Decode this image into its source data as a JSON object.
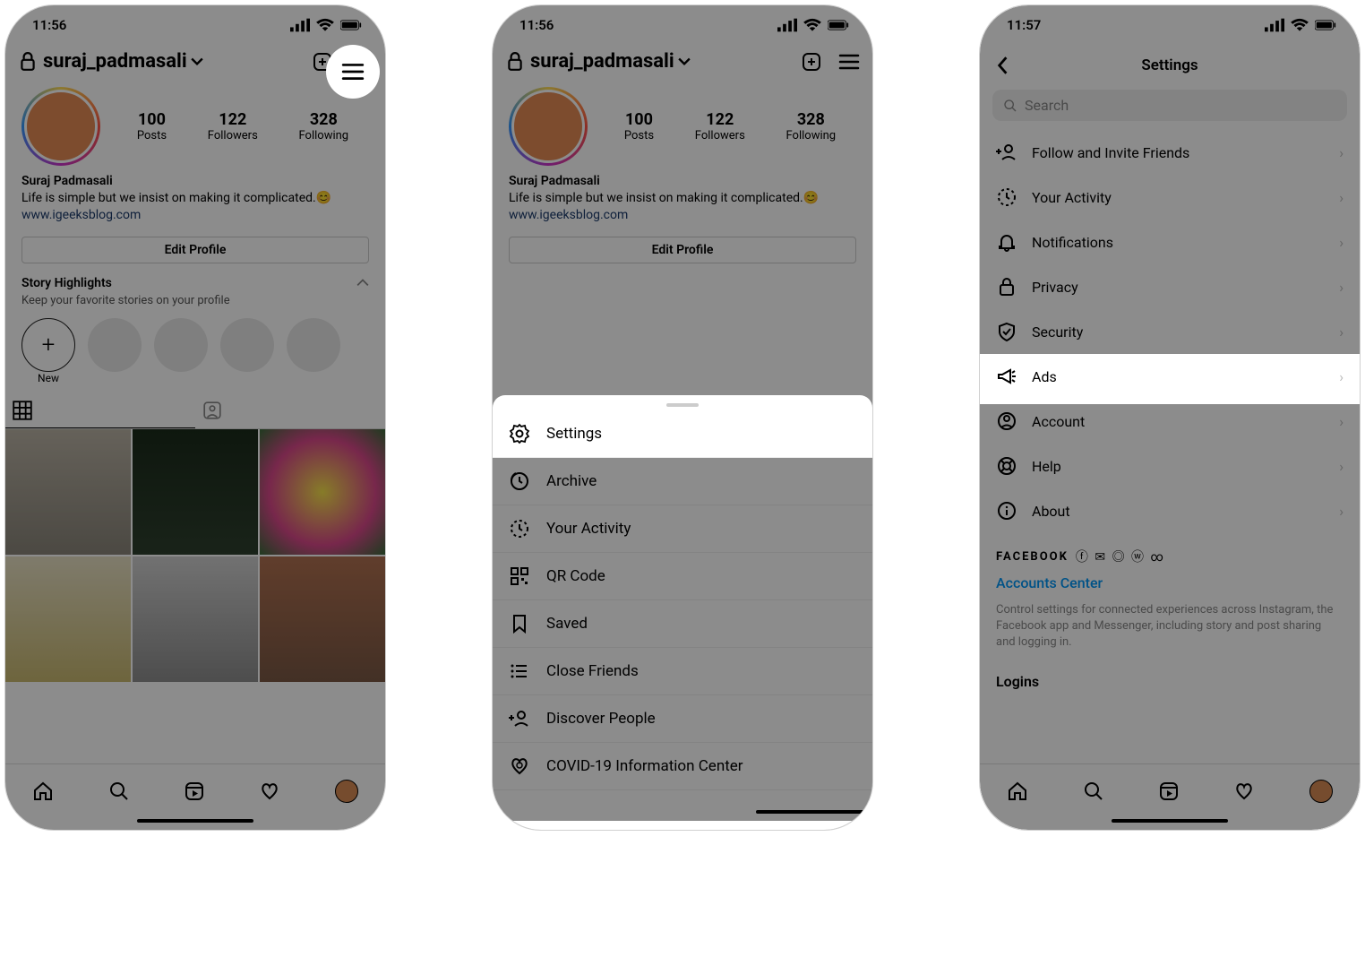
{
  "screen1": {
    "time": "11:56",
    "username": "suraj_padmasali",
    "posts": "100",
    "posts_lbl": "Posts",
    "followers": "122",
    "followers_lbl": "Followers",
    "following": "328",
    "following_lbl": "Following",
    "display_name": "Suraj Padmasali",
    "bio_line": "Life is simple but we insist on making it complicated.😊",
    "link": "www.igeeksblog.com",
    "edit_profile": "Edit Profile",
    "highlights_title": "Story Highlights",
    "highlights_sub": "Keep your favorite stories on your profile",
    "new_label": "New"
  },
  "screen2": {
    "time": "11:56",
    "menu": {
      "settings": "Settings",
      "archive": "Archive",
      "activity": "Your Activity",
      "qr": "QR Code",
      "saved": "Saved",
      "close_friends": "Close Friends",
      "discover": "Discover People",
      "covid": "COVID-19 Information Center"
    }
  },
  "screen3": {
    "time": "11:57",
    "title": "Settings",
    "search_placeholder": "Search",
    "items": {
      "follow": "Follow and Invite Friends",
      "activity": "Your Activity",
      "notifications": "Notifications",
      "privacy": "Privacy",
      "security": "Security",
      "ads": "Ads",
      "account": "Account",
      "help": "Help",
      "about": "About"
    },
    "fb_label": "FACEBOOK",
    "accounts_center": "Accounts Center",
    "fb_desc": "Control settings for connected experiences across Instagram, the Facebook app and Messenger, including story and post sharing and logging in.",
    "logins": "Logins"
  }
}
